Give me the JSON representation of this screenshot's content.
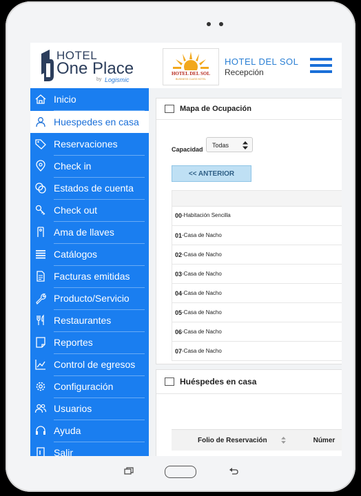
{
  "brand": {
    "hotel": "HOTEL",
    "one_place": "One Place",
    "by": "by",
    "logismic": "Logismic"
  },
  "header": {
    "hotel_logo_text": "HOTEL DEL SOL",
    "hotel_logo_sub": "BUSINESS CLASS HOTEL",
    "hotel_name": "HOTEL DEL SOL",
    "role": "Recepción"
  },
  "sidebar": {
    "items": [
      {
        "label": "Inicio",
        "icon": "home-icon"
      },
      {
        "label": "Huespedes en casa",
        "icon": "user-icon",
        "active": true
      },
      {
        "label": "Reservaciones",
        "icon": "tag-icon"
      },
      {
        "label": "Check in",
        "icon": "location-pin-icon"
      },
      {
        "label": "Estados de cuenta",
        "icon": "account-statement-icon"
      },
      {
        "label": "Check out",
        "icon": "key-icon"
      },
      {
        "label": "Ama de llaves",
        "icon": "door-icon"
      },
      {
        "label": "Catálogos",
        "icon": "list-icon"
      },
      {
        "label": "Facturas emitidas",
        "icon": "invoice-icon"
      },
      {
        "label": "Producto/Servicio",
        "icon": "wrench-icon"
      },
      {
        "label": "Restaurantes",
        "icon": "fork-knife-icon"
      },
      {
        "label": "Reportes",
        "icon": "report-icon"
      },
      {
        "label": "Control de egresos",
        "icon": "chart-icon"
      },
      {
        "label": "Configuración",
        "icon": "gear-icon"
      },
      {
        "label": "Usuarios",
        "icon": "users-icon"
      },
      {
        "label": "Ayuda",
        "icon": "headset-icon"
      },
      {
        "label": "Salir",
        "icon": "exit-icon"
      }
    ]
  },
  "occupancy": {
    "title": "Mapa de Ocupación",
    "capacity_label": "Capacidad",
    "capacity_value": "Todas",
    "prev_button": "<< ANTERIOR",
    "rooms": [
      {
        "num": "00",
        "name": "-Habitación Sencilla"
      },
      {
        "num": "01",
        "name": "-Casa de Nacho"
      },
      {
        "num": "02",
        "name": "-Casa de Nacho"
      },
      {
        "num": "03",
        "name": "-Casa de Nacho"
      },
      {
        "num": "04",
        "name": "-Casa de Nacho"
      },
      {
        "num": "05",
        "name": "-Casa de Nacho"
      },
      {
        "num": "06",
        "name": "-Casa de Nacho"
      },
      {
        "num": "07",
        "name": "-Casa de Nacho"
      }
    ]
  },
  "guests": {
    "title": "Huéspedes en casa",
    "col_folio": "Folio de Reservación",
    "col_num": "Númer"
  },
  "colors": {
    "sidebar": "#1a7ef0",
    "accent": "#2a7fd4"
  }
}
